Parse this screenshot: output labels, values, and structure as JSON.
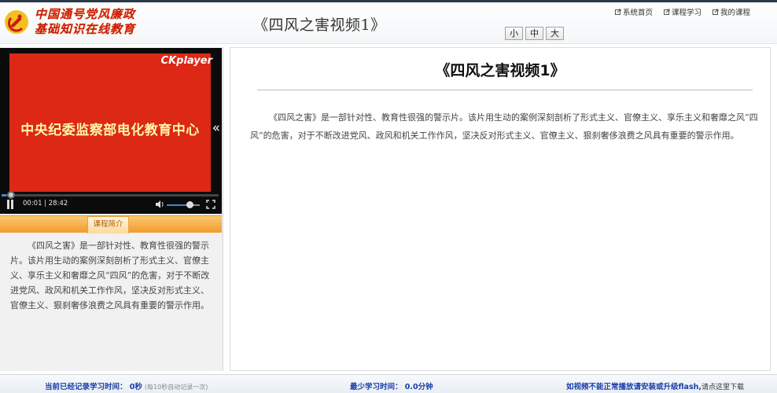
{
  "header": {
    "logo_line1": "中国通号党风廉政",
    "logo_line2": "基础知识在线教育",
    "title": "《四风之害视频1》",
    "font_sizes": [
      "小",
      "中",
      "大"
    ],
    "links": [
      "系统首页",
      "课程学习",
      "我的课程"
    ]
  },
  "player": {
    "brand": "CKplayer",
    "screen_text": "中央纪委监察部电化教育中心",
    "time": "00:01 | 28:42",
    "fold_arrow": "«",
    "progress_fraction": 0.001,
    "volume_fraction": 0.75
  },
  "intro": {
    "tab_label": "课程简介",
    "text": "《四风之害》是一部针对性、教育性很强的警示片。该片用生动的案例深刻剖析了形式主义、官僚主义、享乐主义和奢靡之风“四风”的危害，对于不断改进党风、政风和机关工作作风，坚决反对形式主义、官僚主义、狠刹奢侈浪费之风具有重要的警示作用。"
  },
  "content": {
    "title": "《四风之害视频1》",
    "text": "《四风之害》是一部针对性、教育性很强的警示片。该片用生动的案例深刻剖析了形式主义、官僚主义、享乐主义和奢靡之风“四风”的危害，对于不断改进党风、政风和机关工作作风，坚决反对形式主义、官僚主义、狠刹奢侈浪费之风具有重要的警示作用。"
  },
  "footer": {
    "recorded_label": "当前已经记录学习时间： 0秒",
    "recorded_note": "(每10秒自动记录一次)",
    "min_time_label": "最少学习时间： 0.0分钟",
    "flash_notice": "如视频不能正常播放请安装或升级flash,",
    "flash_link": "请点这里下载"
  },
  "colors": {
    "accent_orange": "#f39a2b",
    "footer_blue": "#1a3eaa",
    "logo_red": "#cc1a10",
    "screen_red": "#dd2815"
  }
}
